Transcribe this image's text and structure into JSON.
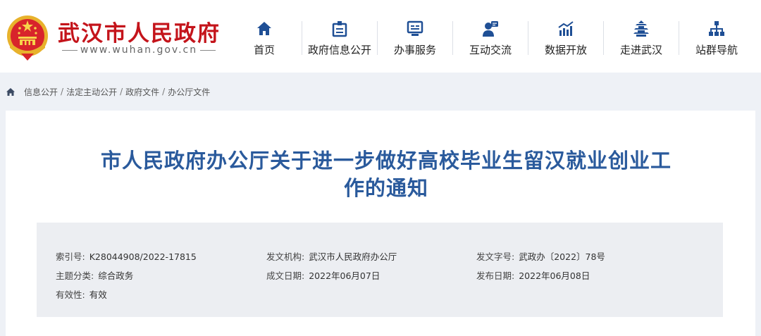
{
  "header": {
    "site_name": "武汉市人民政府",
    "site_url": "www.wuhan.gov.cn",
    "logo_icon": "national-emblem-icon",
    "nav": [
      {
        "label": "首页",
        "icon": "home-icon"
      },
      {
        "label": "政府信息公开",
        "icon": "document-icon"
      },
      {
        "label": "办事服务",
        "icon": "service-screen-icon"
      },
      {
        "label": "互动交流",
        "icon": "chat-person-icon"
      },
      {
        "label": "数据开放",
        "icon": "data-chart-icon"
      },
      {
        "label": "走进武汉",
        "icon": "yellow-crane-tower-icon"
      },
      {
        "label": "站群导航",
        "icon": "sitemap-icon"
      }
    ]
  },
  "breadcrumb": {
    "items": [
      "信息公开",
      "法定主动公开",
      "政府文件",
      "办公厅文件"
    ],
    "separator": "/"
  },
  "article": {
    "title_line1": "市人民政府办公厅关于进一步做好高校毕业生留汉就业创业工",
    "title_line2": "作的通知",
    "meta": {
      "index_no": {
        "label": "索引号:",
        "value": "K28044908/2022-17815"
      },
      "issuer": {
        "label": "发文机构:",
        "value": "武汉市人民政府办公厅"
      },
      "doc_no": {
        "label": "发文字号:",
        "value": "武政办〔2022〕78号"
      },
      "topic": {
        "label": "主题分类:",
        "value": "综合政务"
      },
      "created": {
        "label": "成文日期:",
        "value": "2022年06月07日"
      },
      "published": {
        "label": "发布日期:",
        "value": "2022年06月08日"
      },
      "validity": {
        "label": "有效性:",
        "value": "有效"
      }
    }
  },
  "colors": {
    "brand_red": "#c4141b",
    "title_blue": "#2a5a9c",
    "nav_icon_blue": "#1f4f95",
    "page_bg": "#eef1f6"
  }
}
